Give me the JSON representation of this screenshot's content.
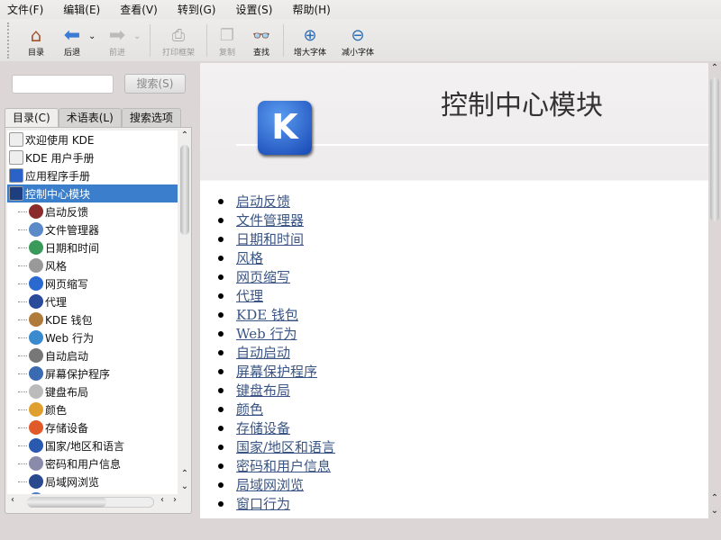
{
  "menubar": [
    "文件(F)",
    "编辑(E)",
    "查看(V)",
    "转到(G)",
    "设置(S)",
    "帮助(H)"
  ],
  "toolbar": {
    "contents": "目录",
    "back": "后退",
    "forward": "前进",
    "print_frame": "打印框架",
    "copy": "复制",
    "find": "查找",
    "zoom_in": "增大字体",
    "zoom_out": "减小字体"
  },
  "search": {
    "value": "",
    "button": "搜索(S)"
  },
  "tabs": [
    "目录(C)",
    "术语表(L)",
    "搜索选项"
  ],
  "tree": {
    "top": [
      {
        "label": "欢迎使用 KDE",
        "icon": "document-icon"
      },
      {
        "label": "KDE 用户手册",
        "icon": "document-icon"
      },
      {
        "label": "应用程序手册",
        "icon": "kde-icon"
      },
      {
        "label": "控制中心模块",
        "icon": "help-book-icon",
        "selected": true
      }
    ],
    "children": [
      "启动反馈",
      "文件管理器",
      "日期和时间",
      "风格",
      "网页缩写",
      "代理",
      "KDE 钱包",
      "Web 行为",
      "自动启动",
      "屏幕保护程序",
      "键盘布局",
      "颜色",
      "存储设备",
      "国家/地区和语言",
      "密码和用户信息",
      "局域网浏览",
      "窗口行为"
    ]
  },
  "content": {
    "title": "控制中心模块",
    "links": [
      "启动反馈",
      "文件管理器",
      "日期和时间",
      "风格",
      "网页缩写",
      "代理",
      "KDE 钱包",
      "Web 行为",
      "自动启动",
      "屏幕保护程序",
      "键盘布局",
      "颜色",
      "存储设备",
      "国家/地区和语言",
      "密码和用户信息",
      "局域网浏览",
      "窗口行为"
    ]
  },
  "colors": {
    "selection": "#3b7fcc",
    "link": "#3a5584"
  }
}
